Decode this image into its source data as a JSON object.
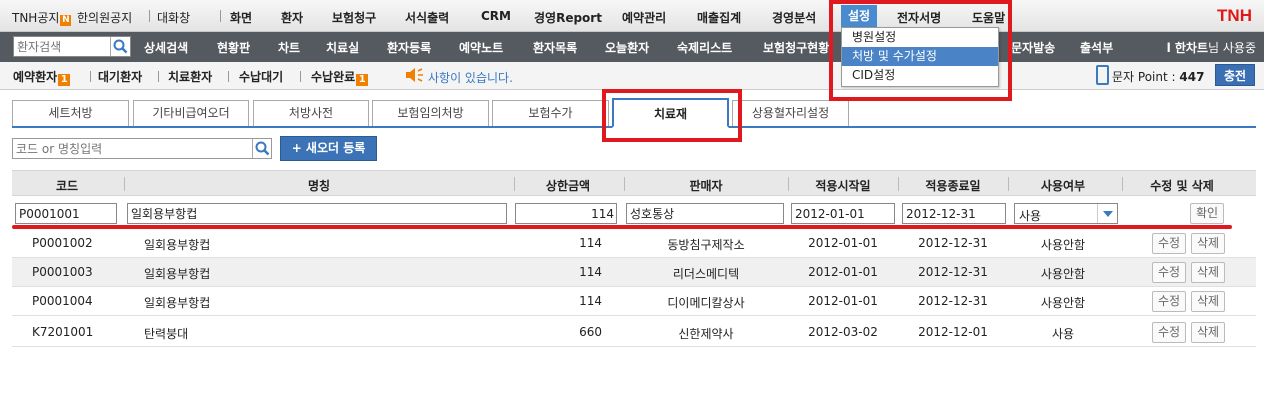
{
  "top_menu": {
    "notice_tnh": "TNH공지",
    "notice_badge": "N",
    "notice_clinic": "한의원공지",
    "chat": "대화창",
    "items": [
      "화면",
      "환자",
      "보험청구",
      "서식출력",
      "CRM",
      "경영Report",
      "예약관리",
      "매출집계",
      "경영분석",
      "설정",
      "전자서명",
      "도움말"
    ],
    "brand": "TNH"
  },
  "settings_dropdown": {
    "items": [
      "병원설정",
      "처방 및 수가설정",
      "CID설정"
    ],
    "active_index": 1
  },
  "nav": {
    "search_placeholder": "환자검색",
    "items": [
      "상세검색",
      "현황판",
      "차트",
      "치료실",
      "환자등록",
      "예약노트",
      "환자목록",
      "오늘환자",
      "숙제리스트",
      "보험청구현황",
      "문자발송",
      "출석부"
    ],
    "user_name": "l 한차트",
    "user_suffix": "님 사용중"
  },
  "sub_bar": {
    "items": [
      {
        "label": "예약환자",
        "badge": "1"
      },
      {
        "label": "대기환자",
        "badge": ""
      },
      {
        "label": "치료환자",
        "badge": ""
      },
      {
        "label": "수납대기",
        "badge": ""
      },
      {
        "label": "수납완료",
        "badge": "1"
      }
    ],
    "notice": "사항이 있습니다.",
    "point_label": "문자 Point :",
    "point_value": "447",
    "charge_label": "충전"
  },
  "tabs": [
    "세트처방",
    "기타비급여오더",
    "처방사전",
    "보험임의처방",
    "보험수가",
    "치료재",
    "상용혈자리설정"
  ],
  "active_tab": "치료재",
  "search": {
    "placeholder": "코드 or 명칭입력",
    "new_order_label": "+ 새오더 등록"
  },
  "table": {
    "headers": [
      "코드",
      "명칭",
      "상한금액",
      "판매자",
      "적용시작일",
      "적용종료일",
      "사용여부",
      "수정 및 삭제"
    ],
    "edit_row": {
      "code": "P0001001",
      "name": "일회용부항컵",
      "price": "114",
      "seller": "성호통상",
      "start": "2012-01-01",
      "end": "2012-12-31",
      "use": "사용",
      "confirm_label": "확인"
    },
    "rows": [
      {
        "code": "P0001002",
        "name": "일회용부항컵",
        "price": "114",
        "seller": "동방침구제작소",
        "start": "2012-01-01",
        "end": "2012-12-31",
        "use": "사용안함"
      },
      {
        "code": "P0001003",
        "name": "일회용부항컵",
        "price": "114",
        "seller": "리더스메디텍",
        "start": "2012-01-01",
        "end": "2012-12-31",
        "use": "사용안함"
      },
      {
        "code": "P0001004",
        "name": "일회용부항컵",
        "price": "114",
        "seller": "디이메디칼상사",
        "start": "2012-01-01",
        "end": "2012-12-31",
        "use": "사용안함"
      },
      {
        "code": "K7201001",
        "name": "탄력붕대",
        "price": "660",
        "seller": "신한제약사",
        "start": "2012-03-02",
        "end": "2012-12-01",
        "use": "사용"
      }
    ],
    "edit_label": "수정",
    "delete_label": "삭제"
  },
  "colors": {
    "accent": "#3a7ac0",
    "highlight_red": "#e01820",
    "nav_bg": "#555a60",
    "badge_orange": "#f08000"
  }
}
